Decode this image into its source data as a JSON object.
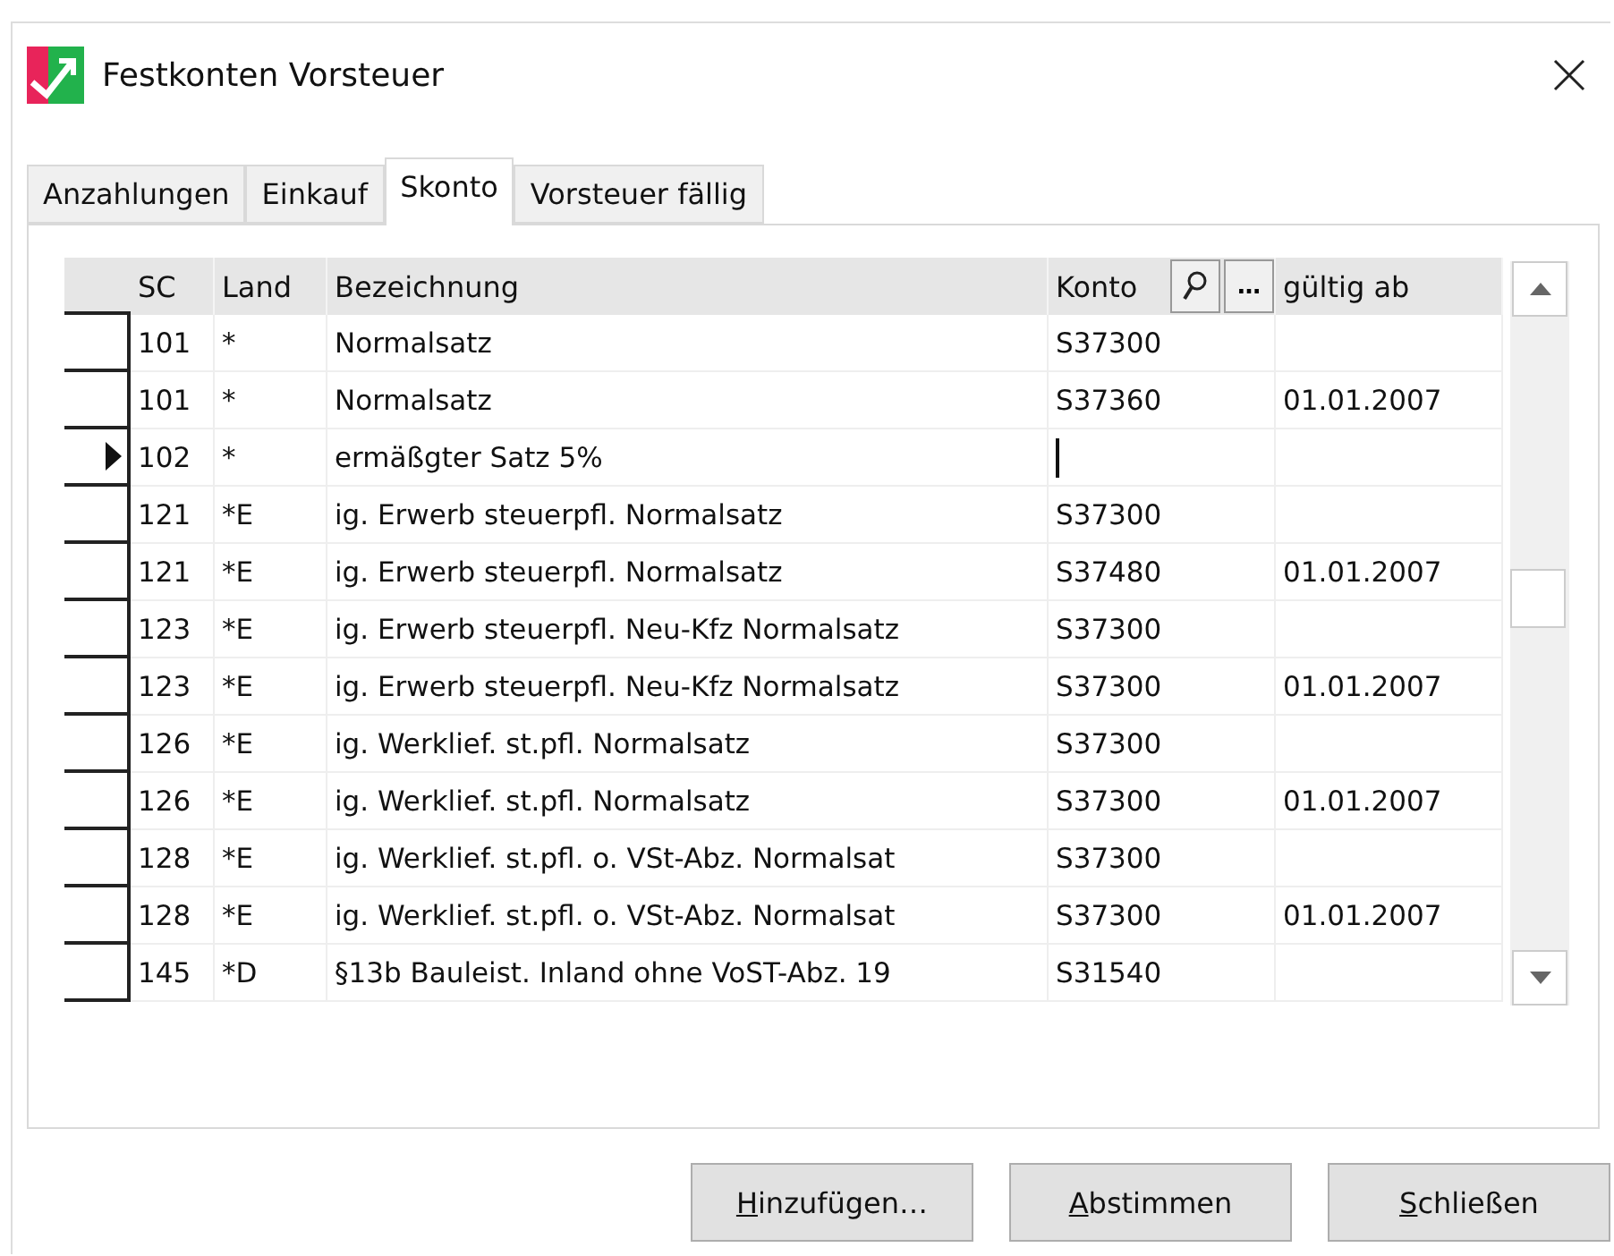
{
  "window": {
    "title": "Festkonten Vorsteuer"
  },
  "tabs": [
    {
      "label": "Anzahlungen",
      "selected": false
    },
    {
      "label": "Einkauf",
      "selected": false
    },
    {
      "label": "Skonto",
      "selected": true
    },
    {
      "label": "Vorsteuer fällig",
      "selected": false
    }
  ],
  "table": {
    "columns": [
      "SC",
      "Land",
      "Bezeichnung",
      "Konto",
      "gültig ab"
    ],
    "konto_more_button": "…",
    "rows": [
      {
        "sc": "101",
        "land": "*",
        "bezeichnung": "Normalsatz",
        "konto": "S37300",
        "selected": false
      },
      {
        "sc": "101",
        "land": "*",
        "bezeichnung": "Normalsatz",
        "konto": "S37360",
        "gueltig_ab": "01.01.2007",
        "selected": false
      },
      {
        "sc": "102",
        "land": "*",
        "bezeichnung": "ermäßgter Satz 5%",
        "selected": true
      },
      {
        "sc": "121",
        "land": "*E",
        "bezeichnung": "ig. Erwerb steuerpfl. Normalsatz",
        "konto": "S37300",
        "selected": false
      },
      {
        "sc": "121",
        "land": "*E",
        "bezeichnung": "ig. Erwerb steuerpfl. Normalsatz",
        "konto": "S37480",
        "gueltig_ab": "01.01.2007",
        "selected": false
      },
      {
        "sc": "123",
        "land": "*E",
        "bezeichnung": "ig. Erwerb steuerpfl. Neu-Kfz Normalsatz",
        "konto": "S37300",
        "selected": false
      },
      {
        "sc": "123",
        "land": "*E",
        "bezeichnung": "ig. Erwerb steuerpfl. Neu-Kfz Normalsatz",
        "konto": "S37300",
        "gueltig_ab": "01.01.2007",
        "selected": false
      },
      {
        "sc": "126",
        "land": "*E",
        "bezeichnung": "ig. Werklief. st.pfl. Normalsatz",
        "konto": "S37300",
        "selected": false
      },
      {
        "sc": "126",
        "land": "*E",
        "bezeichnung": "ig. Werklief. st.pfl. Normalsatz",
        "konto": "S37300",
        "gueltig_ab": "01.01.2007",
        "selected": false
      },
      {
        "sc": "128",
        "land": "*E",
        "bezeichnung": "ig. Werklief. st.pfl. o. VSt-Abz. Normalsat",
        "konto": "S37300",
        "selected": false
      },
      {
        "sc": "128",
        "land": "*E",
        "bezeichnung": "ig. Werklief. st.pfl. o. VSt-Abz. Normalsat",
        "konto": "S37300",
        "gueltig_ab": "01.01.2007",
        "selected": false
      },
      {
        "sc": "145",
        "land": "*D",
        "bezeichnung": "§13b Bauleist. Inland ohne VoST-Abz. 19",
        "konto": "S31540",
        "selected": false
      }
    ]
  },
  "buttons": [
    {
      "mnemonic": "H",
      "label": "inzufügen…"
    },
    {
      "mnemonic": "A",
      "label": "bstimmen"
    },
    {
      "mnemonic": "S",
      "label": "chließen"
    }
  ]
}
